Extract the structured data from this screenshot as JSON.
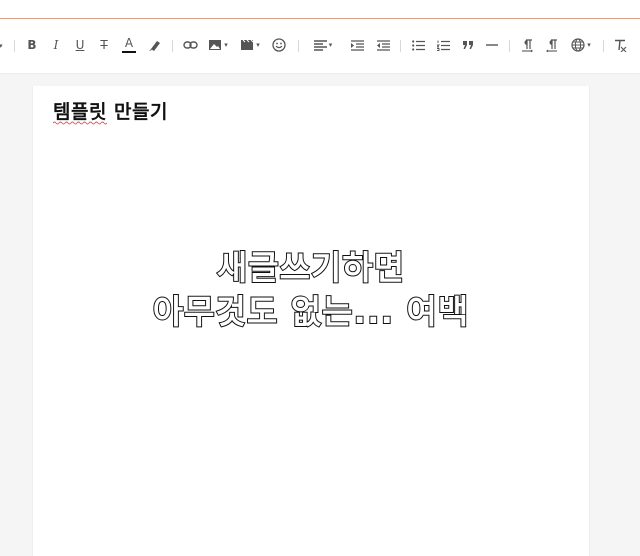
{
  "toolbar": {
    "bold": "B",
    "italic": "I",
    "underline": "U",
    "strikethrough": "T",
    "font_color": "A",
    "font_color_bar": "#111111"
  },
  "document": {
    "title": "템플릿 만들기",
    "placeholder_lines": [
      "새글쓰기하면",
      "아무것도 없는... 여백"
    ]
  },
  "colors": {
    "accent_line": "#d9a58a",
    "spellcheck_underline": "#e25555"
  }
}
